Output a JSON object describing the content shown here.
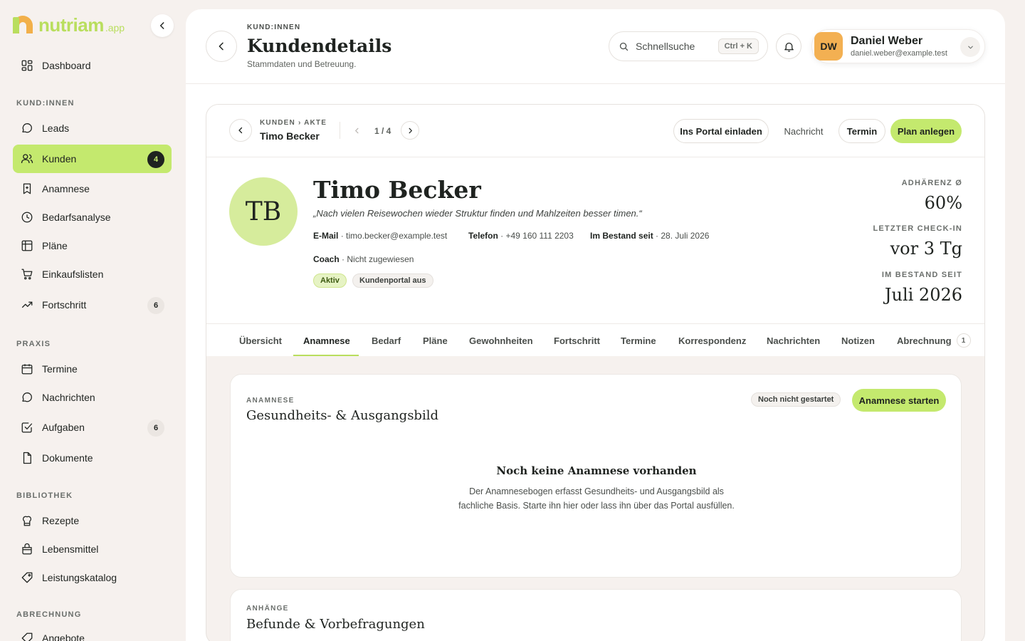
{
  "brand": {
    "name": "nutriam",
    "suffix": ".app",
    "primary": "#c4e96e",
    "accent": "#f2b04a"
  },
  "sidebar": {
    "items": [
      {
        "label": "Dashboard",
        "icon": "dashboard-grid-icon"
      },
      {
        "label": "Leads",
        "icon": "chat-bubble-icon"
      },
      {
        "label": "Kunden",
        "icon": "users-icon",
        "badge": "4",
        "active": true
      },
      {
        "label": "Anamnese",
        "icon": "bookmark-plus-icon"
      },
      {
        "label": "Bedarfsanalyse",
        "icon": "clock-icon"
      },
      {
        "label": "Pläne",
        "icon": "table-icon"
      },
      {
        "label": "Einkaufslisten",
        "icon": "cart-icon"
      },
      {
        "label": "Fortschritt",
        "icon": "trend-up-icon",
        "badge": "6"
      },
      {
        "label": "Termine",
        "icon": "calendar-icon"
      },
      {
        "label": "Nachrichten",
        "icon": "message-icon"
      },
      {
        "label": "Aufgaben",
        "icon": "checkbox-icon",
        "badge": "6"
      },
      {
        "label": "Dokumente",
        "icon": "document-icon"
      },
      {
        "label": "Rezepte",
        "icon": "chef-hat-icon"
      },
      {
        "label": "Lebensmittel",
        "icon": "bag-icon"
      },
      {
        "label": "Leistungskatalog",
        "icon": "tag-icon"
      },
      {
        "label": "Angebote",
        "icon": "offer-icon"
      }
    ],
    "sections": [
      "KUND:INNEN",
      "PRAXIS",
      "BIBLIOTHEK",
      "ABRECHNUNG"
    ]
  },
  "header": {
    "eyebrow": "KUND:INNEN",
    "title": "Kundendetails",
    "subtitle": "Stammdaten und Betreuung.",
    "search_placeholder": "Schnellsuche",
    "search_shortcut": "Ctrl + K",
    "user": {
      "initials": "DW",
      "name": "Daniel Weber",
      "email": "daniel.weber@example.test"
    }
  },
  "record_nav": {
    "breadcrumb": "KUNDEN › AKTE",
    "name": "Timo Becker",
    "pager": "1 / 4",
    "actions": {
      "invite": "Ins Portal einladen",
      "message": "Nachricht",
      "appointment": "Termin",
      "plan": "Plan anlegen"
    }
  },
  "client": {
    "initials": "TB",
    "name": "Timo Becker",
    "quote": "„Nach vielen Reisewochen wieder Struktur finden und Mahlzeiten besser timen.“",
    "email_label": "E-Mail",
    "email": "· timo.becker@example.test",
    "phone_label": "Telefon",
    "phone": "· +49 160 111 2203",
    "since_label": "Im Bestand seit",
    "since": "· 28. Juli 2026",
    "coach_label": "Coach",
    "coach": "· Nicht zugewiesen",
    "tags": [
      "Aktiv",
      "Kundenportal aus"
    ]
  },
  "stats": [
    {
      "label": "ADHÄRENZ Ø",
      "value": "60%"
    },
    {
      "label": "LETZTER CHECK-IN",
      "value": "vor 3 Tg"
    },
    {
      "label": "IM BESTAND SEIT",
      "value": "Juli 2026"
    }
  ],
  "tabs": [
    {
      "label": "Übersicht"
    },
    {
      "label": "Anamnese",
      "active": true
    },
    {
      "label": "Bedarf"
    },
    {
      "label": "Pläne"
    },
    {
      "label": "Gewohnheiten"
    },
    {
      "label": "Fortschritt"
    },
    {
      "label": "Termine"
    },
    {
      "label": "Korrespondenz"
    },
    {
      "label": "Nachrichten"
    },
    {
      "label": "Notizen"
    },
    {
      "label": "Abrechnung",
      "badge": "1"
    }
  ],
  "anamnese": {
    "eyebrow": "ANAMNESE",
    "title": "Gesundheits- & Ausgangsbild",
    "status": "Noch nicht gestartet",
    "start_label": "Anamnese starten",
    "empty_title": "Noch keine Anamnese vorhanden",
    "empty_text": "Der Anamnesebogen erfasst Gesundheits- und Ausgangsbild als fachliche Basis. Starte ihn hier oder lass ihn über das Portal ausfüllen."
  },
  "attachments": {
    "eyebrow": "ANHÄNGE",
    "title": "Befunde & Vorbefragungen"
  }
}
